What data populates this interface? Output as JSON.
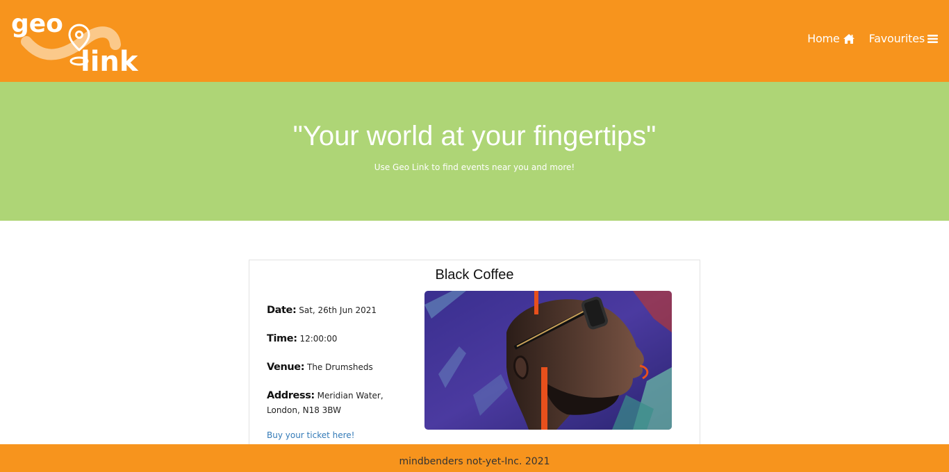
{
  "header": {
    "logo_text_top": "geo",
    "logo_text_bottom": "link",
    "nav": [
      {
        "label": "Home",
        "icon": "home-icon"
      },
      {
        "label": "Favourites",
        "icon": "menu-icon"
      }
    ]
  },
  "hero": {
    "title": "\"Your world at your fingertips\"",
    "subtitle": "Use Geo Link to find events near you and more!"
  },
  "event": {
    "title": "Black Coffee",
    "date_label": "Date:",
    "date_value": "Sat, 26th Jun 2021",
    "time_label": "Time:",
    "time_value": "12:00:00",
    "venue_label": "Venue:",
    "venue_value": "The Drumsheds",
    "address_label": "Address:",
    "address_value": "Meridian Water, London, N18 3BW",
    "ticket_link": "Buy your ticket here!"
  },
  "footer": {
    "text": "mindbenders not-yet-Inc. 2021"
  },
  "colors": {
    "header": "#f7941d",
    "hero": "#aed576",
    "link": "#337ab7"
  }
}
